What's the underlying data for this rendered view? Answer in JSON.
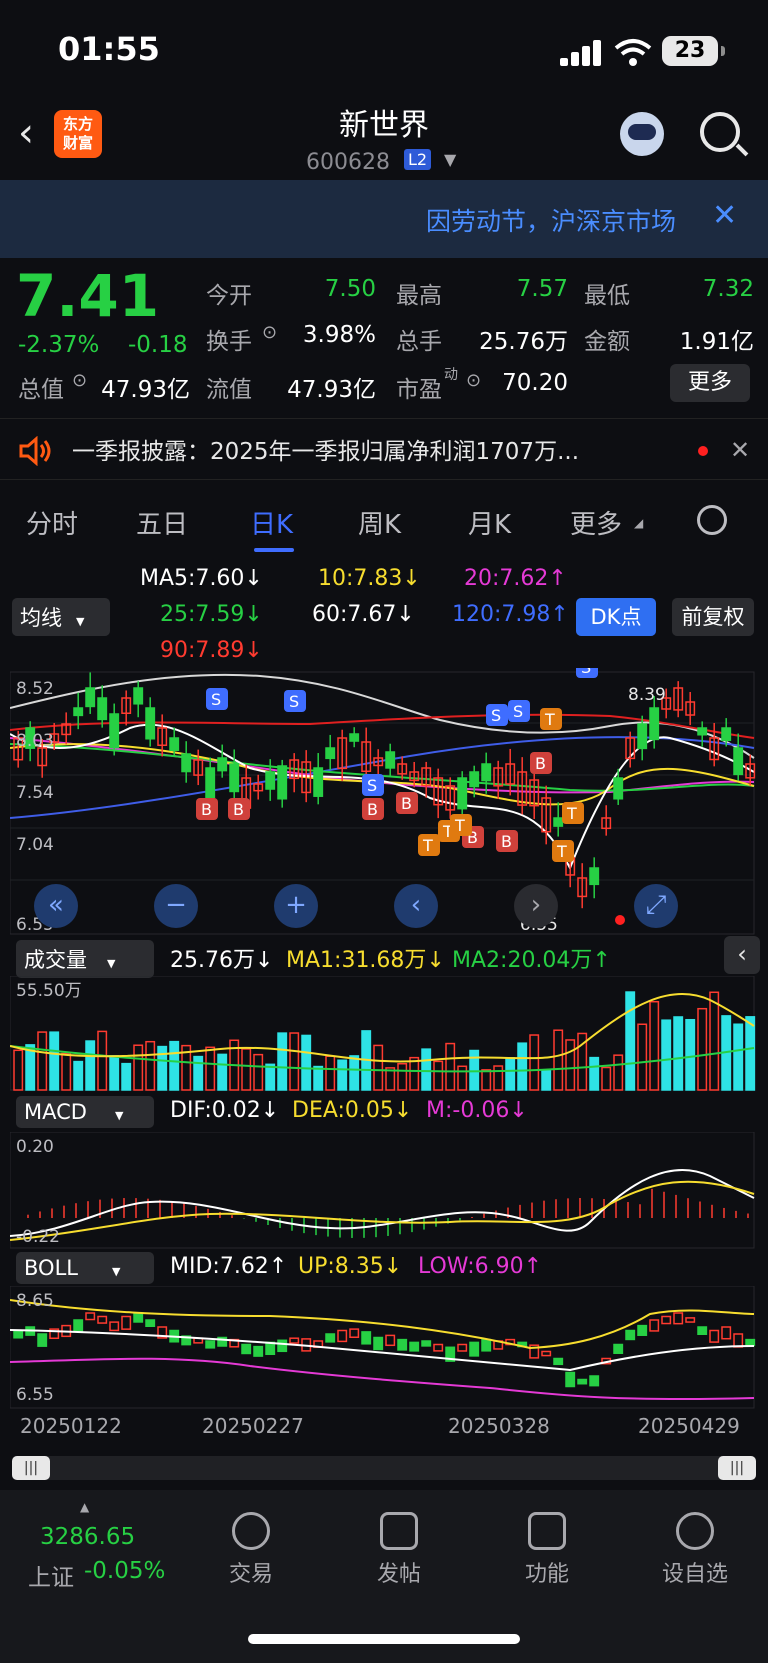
{
  "status_bar": {
    "time": "01:55",
    "battery": "23"
  },
  "header": {
    "name": "新世界",
    "code": "600628",
    "badge": "L2"
  },
  "notice": {
    "text": "因劳动节，沪深京市场"
  },
  "quote": {
    "price": "7.41",
    "pct": "-2.37%",
    "change": "-0.18",
    "open_label": "今开",
    "open": "7.50",
    "high_label": "最高",
    "high": "7.57",
    "low_label": "最低",
    "low": "7.32",
    "turnover_label": "换手",
    "turnover": "3.98%",
    "volume_label": "总手",
    "volume": "25.76万",
    "amount_label": "金额",
    "amount": "1.91亿",
    "mktcap_label": "总值",
    "mktcap": "47.93亿",
    "float_label": "流值",
    "float": "47.93亿",
    "pe_label": "市盈",
    "pe_sup": "动",
    "pe": "70.20",
    "more": "更多"
  },
  "news": {
    "text": "一季报披露：2025年一季报归属净利润1707万..."
  },
  "tabs": [
    "分时",
    "五日",
    "日K",
    "周K",
    "月K",
    "更多"
  ],
  "active_tab": "日K",
  "ma": {
    "ma5": "MA5:7.60",
    "ma10": "10:7.83",
    "ma20": "20:7.62",
    "ma25": "25:7.59",
    "ma60": "60:7.67",
    "ma120": "120:7.98",
    "ma90": "90:7.89",
    "select": "均线",
    "dk": "DK点",
    "fq": "前复权"
  },
  "main_axis": [
    "8.52",
    "8.03",
    "7.54",
    "7.04",
    "6.55"
  ],
  "main_annot": {
    "high": "8.39",
    "low": "6.55"
  },
  "volume": {
    "select": "成交量",
    "vol": "25.76万",
    "ma1": "MA1:31.68万",
    "ma2": "MA2:20.04万",
    "axis_top": "55.50万"
  },
  "macd": {
    "select": "MACD",
    "dif": "DIF:0.02",
    "dea": "DEA:0.05",
    "m": "M:-0.06",
    "axis_top": "0.20",
    "axis_bottom": "-0.22"
  },
  "boll": {
    "select": "BOLL",
    "mid": "MID:7.62",
    "up": "UP:8.35",
    "low": "LOW:6.90",
    "axis_top": "8.65",
    "axis_bottom": "6.55"
  },
  "dates": [
    "20250122",
    "20250227",
    "20250328",
    "20250429"
  ],
  "index": {
    "value": "3286.65",
    "name": "上证",
    "pct": "-0.05%"
  },
  "nav": [
    "交易",
    "发帖",
    "功能",
    "设自选"
  ],
  "colors": {
    "up": "#ff3b30",
    "down": "#27d044",
    "accent": "#3f6dff",
    "bg": "#0d0e12"
  }
}
